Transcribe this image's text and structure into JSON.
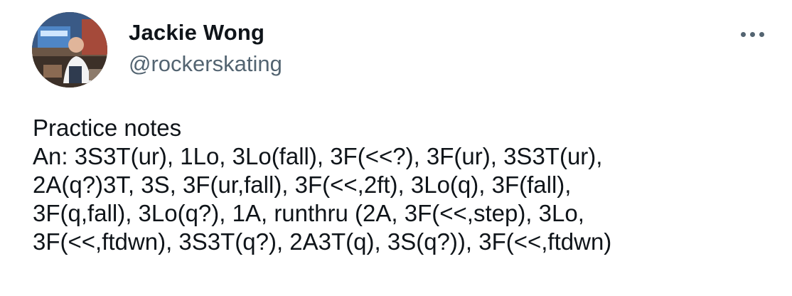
{
  "author": {
    "name": "Jackie Wong",
    "handle": "@rockerskating",
    "avatar_icon": "profile-photo-avatar"
  },
  "menu": {
    "icon": "more-options-icon"
  },
  "tweet": {
    "lines": [
      "Practice notes",
      "An: 3S3T(ur), 1Lo, 3Lo(fall), 3F(<<?), 3F(ur), 3S3T(ur),",
      "2A(q?)3T, 3S, 3F(ur,fall), 3F(<<,2ft), 3Lo(q), 3F(fall),",
      "3F(q,fall), 3Lo(q?), 1A, runthru (2A, 3F(<<,step), 3Lo,",
      "3F(<<,ftdwn), 3S3T(q?), 2A3T(q), 3S(q?)), 3F(<<,ftdwn)"
    ]
  },
  "colors": {
    "text_primary": "#0f1419",
    "text_secondary": "#536471",
    "background": "#ffffff"
  }
}
